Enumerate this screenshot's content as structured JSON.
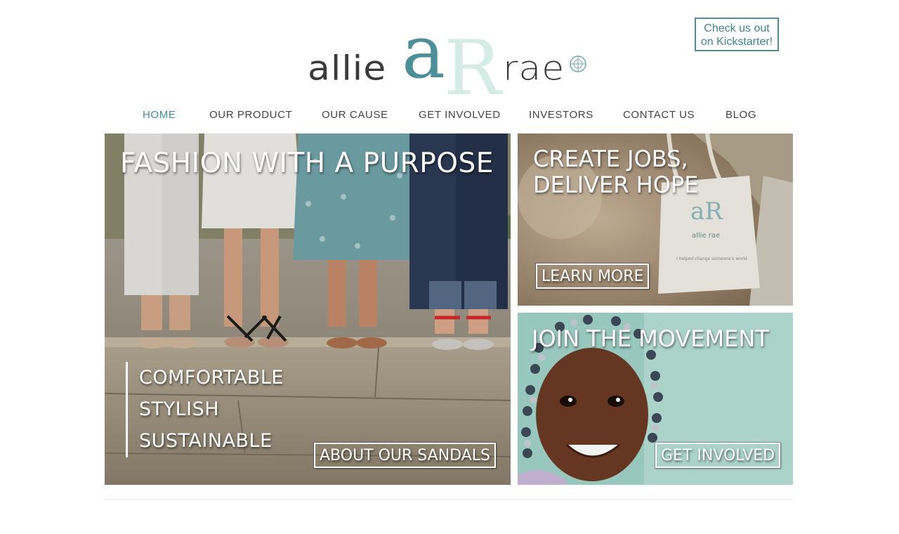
{
  "header": {
    "logo": {
      "word_left": "allie",
      "word_right": "rae",
      "monogram_a": "a",
      "monogram_r": "R",
      "colors": {
        "primary": "#4d8f98",
        "light": "#d5ebe6",
        "text": "#3a3a3a"
      }
    },
    "kickstarter": {
      "line1": "Check us out",
      "line2": "on Kickstarter!"
    }
  },
  "nav": {
    "items": [
      {
        "label": "HOME",
        "active": true
      },
      {
        "label": "OUR PRODUCT",
        "active": false
      },
      {
        "label": "OUR CAUSE",
        "active": false
      },
      {
        "label": "GET INVOLVED",
        "active": false
      },
      {
        "label": "INVESTORS",
        "active": false
      },
      {
        "label": "CONTACT US",
        "active": false
      },
      {
        "label": "BLOG",
        "active": false
      }
    ],
    "active_color": "#3d8a94"
  },
  "tiles": {
    "main": {
      "title": "FASHION WITH A PURPOSE",
      "features": [
        "COMFORTABLE",
        "STYLISH",
        "SUSTAINABLE"
      ],
      "cta": "ABOUT OUR SANDALS"
    },
    "jobs": {
      "title_line1": "CREATE JOBS,",
      "title_line2": "DELIVER HOPE",
      "cta": "LEARN MORE",
      "bag_text": {
        "brand": "allie rae",
        "tagline": "I helped change someone's world"
      }
    },
    "movement": {
      "title": "JOIN THE MOVEMENT",
      "cta": "GET INVOLVED"
    }
  }
}
